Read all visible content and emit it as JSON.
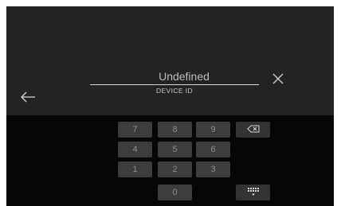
{
  "field": {
    "value": "Undefined",
    "label": "DEVICE ID"
  },
  "keypad": {
    "rows": [
      [
        "7",
        "8",
        "9"
      ],
      [
        "4",
        "5",
        "6"
      ],
      [
        "1",
        "2",
        "3"
      ],
      [
        "0"
      ]
    ]
  },
  "icons": {
    "back": "arrow-left-icon",
    "clear": "close-icon",
    "backspace": "backspace-icon",
    "keyboard": "keyboard-hide-icon"
  },
  "colors": {
    "top_background": "#232323",
    "keypad_background": "#060606",
    "key_background": "#3c3c3c",
    "key_text": "#8f8f8f",
    "field_text": "#bdbdbd"
  }
}
